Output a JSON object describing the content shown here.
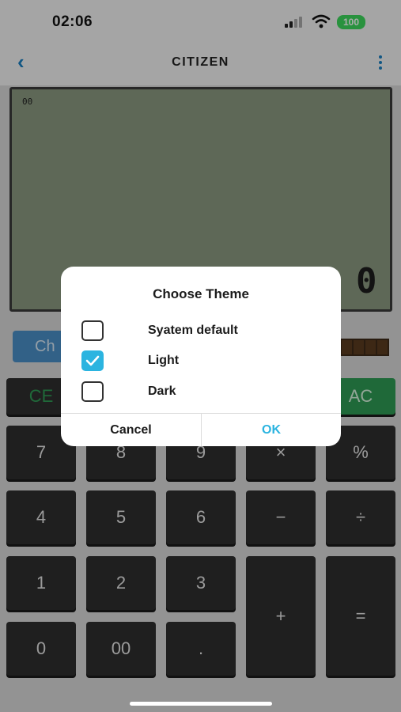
{
  "status_bar": {
    "time": "02:06",
    "battery": "100"
  },
  "header": {
    "title": "CITIZEN"
  },
  "display": {
    "indicator": "00",
    "value": "0"
  },
  "theme_button_label": "Ch",
  "keys": {
    "ce": "CE",
    "ac": "AC",
    "seven": "7",
    "eight": "8",
    "nine": "9",
    "multiply": "×",
    "percent": "%",
    "four": "4",
    "five": "5",
    "six": "6",
    "minus": "−",
    "divide": "÷",
    "one": "1",
    "two": "2",
    "three": "3",
    "plus": "+",
    "equals": "=",
    "zero": "0",
    "double_zero": "00",
    "dot": "."
  },
  "dialog": {
    "title": "Choose Theme",
    "options": [
      {
        "label": "Syatem default",
        "checked": false
      },
      {
        "label": "Light",
        "checked": true
      },
      {
        "label": "Dark",
        "checked": false
      }
    ],
    "cancel": "Cancel",
    "ok": "OK"
  },
  "colors": {
    "accent": "#2bb4e0",
    "lcd": "#8b9a80",
    "key": "#2f2f2f",
    "green_key": "#2f9b55"
  }
}
